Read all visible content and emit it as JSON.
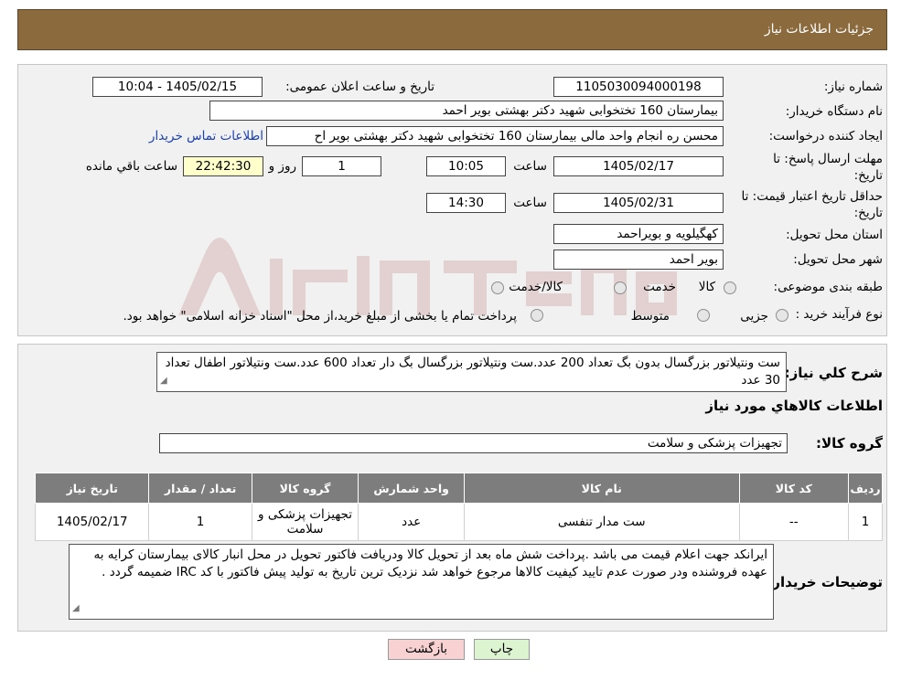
{
  "header": {
    "title": "جزئیات اطلاعات نیاز"
  },
  "form": {
    "need_number_label": "شماره نیاز:",
    "need_number": "1105030094000198",
    "announce_label": "تاریخ و ساعت اعلان عمومی:",
    "announce_value": "1405/02/15 - 10:04",
    "buyer_org_label": "نام دستگاه خریدار:",
    "buyer_org": "بیمارستان 160 تختخوابی شهید دکتر بهشتی بویر احمد",
    "requester_label": "ایجاد کننده درخواست:",
    "requester": "محسن ره انجام واحد مالی بیمارستان 160 تختخوابی شهید دکتر بهشتی بویر اح",
    "contact_link": "اطلاعات تماس خریدار",
    "deadline_label_1": "مهلت ارسال پاسخ: تا",
    "deadline_label_2": "تاریخ:",
    "deadline_date": "1405/02/17",
    "time_label": "ساعت",
    "deadline_time": "10:05",
    "days_value": "1",
    "days_label": "روز و",
    "remaining_time": "22:42:30",
    "remaining_label": "ساعت باقي مانده",
    "validity_label_1": "حداقل تاريخ اعتبار قیمت: تا",
    "validity_label_2": "تاریخ:",
    "validity_date": "1405/02/31",
    "validity_time": "14:30",
    "province_label": "استان محل تحویل:",
    "province": "کهگیلویه و بویراحمد",
    "city_label": "شهر محل تحویل:",
    "city": "بویر احمد",
    "category_label": "طبقه بندی موضوعی:",
    "category_options": [
      "کالا",
      "خدمت",
      "کالا/خدمت"
    ],
    "purchase_type_label": "نوع فرآیند خرید :",
    "purchase_type_options": [
      "جزیی",
      "متوسط"
    ],
    "purchase_note": "پرداخت تمام یا بخشی از مبلغ خرید،از محل \"اسناد خزانه اسلامی\" خواهد بود."
  },
  "summary": {
    "label": "شرح كلي نياز:",
    "text": "ست ونتیلاتور بزرگسال بدون بگ تعداد 200 عدد.ست ونتیلاتور بزرگسال بگ دار تعداد 600 عدد.ست ونتیلاتور اطفال تعداد 30 عدد"
  },
  "items_section": {
    "title": "اطلاعات كالاهاي مورد نياز",
    "group_label": "گروه کالا:",
    "group_value": "تجهیزات پزشکی و سلامت"
  },
  "table": {
    "headers": [
      "ردیف",
      "کد کالا",
      "نام کالا",
      "واحد شمارش",
      "گروه کالا",
      "تعداد / مقدار",
      "تاریخ نیاز"
    ],
    "rows": [
      [
        "1",
        "--",
        "ست مدار تنفسی",
        "عدد",
        "تجهیزات پزشکی و سلامت",
        "1",
        "1405/02/17"
      ]
    ]
  },
  "buyer_notes": {
    "label": "توضیحات خریدار:",
    "text": "ایرانکد جهت اعلام قیمت می باشد .پرداخت شش ماه بعد از تحویل کالا ودریافت فاکتور تحویل در محل انبار کالای بیمارستان کرایه به عهده فروشنده ودر صورت عدم تایید کیفیت کالاها مرجوع خواهد شد نزدیک ترین تاریخ به تولید پیش فاکتور با کد IRC ضمیمه گردد ."
  },
  "buttons": {
    "print": "چاپ",
    "back": "بازگشت"
  },
  "colors": {
    "header_bg": "#8b6a3e",
    "table_header_bg": "#7d7d7d",
    "back_button_bg": "#f8d2d2",
    "print_button_bg": "#dcf5d0",
    "link": "#1a3fb0"
  }
}
